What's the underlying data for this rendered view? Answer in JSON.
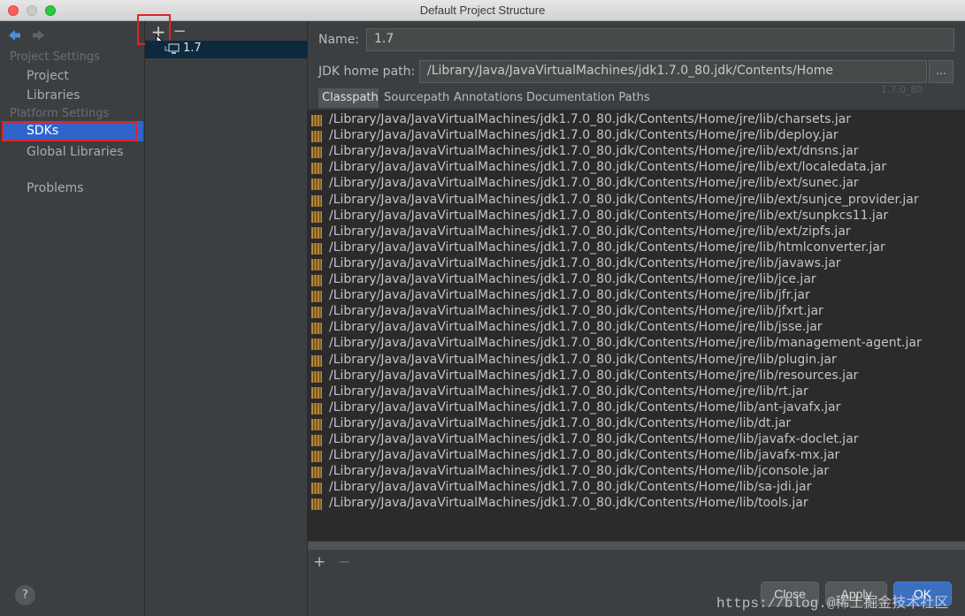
{
  "window": {
    "title": "Default Project Structure"
  },
  "sidebar": {
    "project_settings_heading": "Project Settings",
    "project_item": "Project",
    "libraries_item": "Libraries",
    "platform_settings_heading": "Platform Settings",
    "sdks_item": "SDKs",
    "global_libraries_item": "Global Libraries",
    "problems_item": "Problems",
    "help_label": "?"
  },
  "sdk_panel": {
    "add_label": "+",
    "remove_label": "−",
    "sdk_name": "1.7"
  },
  "main": {
    "name_label": "Name:",
    "name_value": "1.7",
    "jdk_home_label": "JDK home path:",
    "jdk_home_value": "/Library/Java/JavaVirtualMachines/jdk1.7.0_80.jdk/Contents/Home",
    "browse_label": "...",
    "ghost_version": "1.7.0_80",
    "tabs": [
      "Classpath",
      "Sourcepath",
      "Annotations",
      "Documentation Paths"
    ],
    "active_tab": "Classpath",
    "classpath": [
      "/Library/Java/JavaVirtualMachines/jdk1.7.0_80.jdk/Contents/Home/jre/lib/charsets.jar",
      "/Library/Java/JavaVirtualMachines/jdk1.7.0_80.jdk/Contents/Home/jre/lib/deploy.jar",
      "/Library/Java/JavaVirtualMachines/jdk1.7.0_80.jdk/Contents/Home/jre/lib/ext/dnsns.jar",
      "/Library/Java/JavaVirtualMachines/jdk1.7.0_80.jdk/Contents/Home/jre/lib/ext/localedata.jar",
      "/Library/Java/JavaVirtualMachines/jdk1.7.0_80.jdk/Contents/Home/jre/lib/ext/sunec.jar",
      "/Library/Java/JavaVirtualMachines/jdk1.7.0_80.jdk/Contents/Home/jre/lib/ext/sunjce_provider.jar",
      "/Library/Java/JavaVirtualMachines/jdk1.7.0_80.jdk/Contents/Home/jre/lib/ext/sunpkcs11.jar",
      "/Library/Java/JavaVirtualMachines/jdk1.7.0_80.jdk/Contents/Home/jre/lib/ext/zipfs.jar",
      "/Library/Java/JavaVirtualMachines/jdk1.7.0_80.jdk/Contents/Home/jre/lib/htmlconverter.jar",
      "/Library/Java/JavaVirtualMachines/jdk1.7.0_80.jdk/Contents/Home/jre/lib/javaws.jar",
      "/Library/Java/JavaVirtualMachines/jdk1.7.0_80.jdk/Contents/Home/jre/lib/jce.jar",
      "/Library/Java/JavaVirtualMachines/jdk1.7.0_80.jdk/Contents/Home/jre/lib/jfr.jar",
      "/Library/Java/JavaVirtualMachines/jdk1.7.0_80.jdk/Contents/Home/jre/lib/jfxrt.jar",
      "/Library/Java/JavaVirtualMachines/jdk1.7.0_80.jdk/Contents/Home/jre/lib/jsse.jar",
      "/Library/Java/JavaVirtualMachines/jdk1.7.0_80.jdk/Contents/Home/jre/lib/management-agent.jar",
      "/Library/Java/JavaVirtualMachines/jdk1.7.0_80.jdk/Contents/Home/jre/lib/plugin.jar",
      "/Library/Java/JavaVirtualMachines/jdk1.7.0_80.jdk/Contents/Home/jre/lib/resources.jar",
      "/Library/Java/JavaVirtualMachines/jdk1.7.0_80.jdk/Contents/Home/jre/lib/rt.jar",
      "/Library/Java/JavaVirtualMachines/jdk1.7.0_80.jdk/Contents/Home/lib/ant-javafx.jar",
      "/Library/Java/JavaVirtualMachines/jdk1.7.0_80.jdk/Contents/Home/lib/dt.jar",
      "/Library/Java/JavaVirtualMachines/jdk1.7.0_80.jdk/Contents/Home/lib/javafx-doclet.jar",
      "/Library/Java/JavaVirtualMachines/jdk1.7.0_80.jdk/Contents/Home/lib/javafx-mx.jar",
      "/Library/Java/JavaVirtualMachines/jdk1.7.0_80.jdk/Contents/Home/lib/jconsole.jar",
      "/Library/Java/JavaVirtualMachines/jdk1.7.0_80.jdk/Contents/Home/lib/sa-jdi.jar",
      "/Library/Java/JavaVirtualMachines/jdk1.7.0_80.jdk/Contents/Home/lib/tools.jar"
    ],
    "list_add_label": "+",
    "list_remove_label": "−"
  },
  "buttons": {
    "close": "Close",
    "apply": "Apply",
    "ok": "OK"
  },
  "watermark": "https://blog.@稀土掘金技术社区",
  "colors": {
    "background": "#3c3f41",
    "list_background": "#2b2b2b",
    "selection": "#2f65ca",
    "highlight_box": "#e0232b",
    "ok_button": "#3b6fbf"
  },
  "icons": {
    "back": "back-arrow-icon",
    "forward": "forward-arrow-icon",
    "jar": "jar-icon",
    "sdk": "sdk-icon",
    "cursor": "mouse-cursor-icon"
  }
}
